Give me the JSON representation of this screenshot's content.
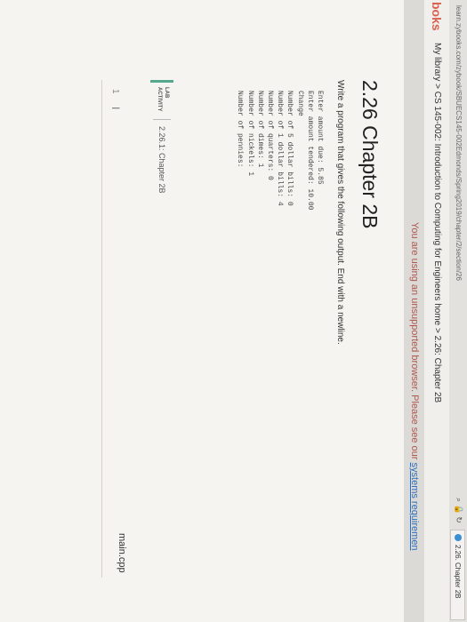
{
  "browser": {
    "url": "learn.zybooks.com/zybook/SBUECS145-002Edmonds/Spring2019/chapter/2/section/26",
    "tab_title": "2.26. Chapter 2B",
    "icons": [
      "search-icon",
      "lock-icon",
      "refresh-icon"
    ]
  },
  "nav": {
    "brand": "boks",
    "breadcrumb": "My library > CS 145-002: Introduction to Computing for Engineers home > 2.26: Chapter 2B"
  },
  "banner": {
    "text": "You are using an unsupported browser. Please see our",
    "link": "systems requiremen"
  },
  "section": {
    "title": "2.26 Chapter 2B",
    "instructions": "Write a program that gives the following output. End with a newline.",
    "sample_output": [
      "Enter amount due: 5.85",
      "Enter amount tendered: 10.00",
      "",
      "Change",
      "Number of 5 dollar bills: 0",
      "Number of 1 dollar bills: 4",
      "Number of quarters: 0",
      "Number of dimes: 1",
      "Number of nickels: 1",
      "Number of pennies:"
    ]
  },
  "lab": {
    "tag": "LAB ACTIVITY",
    "name": "2.26.1: Chapter 2B"
  },
  "editor": {
    "filename": "main.cpp",
    "line_number": "1"
  },
  "colors": {
    "brand": "#d9604f",
    "banner_text": "#b0574c",
    "link": "#2a6fc2",
    "lab_accent": "#54a88d"
  }
}
